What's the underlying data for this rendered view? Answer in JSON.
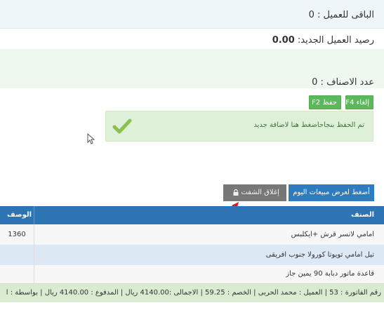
{
  "info": {
    "remaining_label": "الباقى للعميل : 0",
    "new_balance_label": "رصيد العميل الجديد:",
    "new_balance_value": "0.00",
    "items_count_label": "عدد الاصناف :  0"
  },
  "actions": {
    "cancel_label": "إلغاء F4",
    "save_label": "حفظ F2"
  },
  "alert": {
    "message": "تم الحفظ بنجاحاضغط هنا لاضافة جديد"
  },
  "buttons": {
    "today_sales_label": "أضغط لعرض مبيعات اليوم",
    "close_shift_label": "إغلاق الشفت"
  },
  "table": {
    "headers": {
      "item": "الصنف",
      "desc": "الوصف"
    },
    "rows": [
      {
        "name": "امامي لانسر قرش +ايكلبس",
        "desc": "1360"
      },
      {
        "name": "تيل امامي تويوتا كورولا جنوب افريقى",
        "desc": ""
      },
      {
        "name": "قاعدة ماتور دبابة 90 يمين جاز",
        "desc": ""
      }
    ]
  },
  "footer": {
    "text": "رقم الفاتورة : 53 | العميل : محمد الحربى | الخصم : 59.25 | الاجمالى :4140.00 ريال | المدفوع : 4140.00 ريال | بواسطة : ا"
  },
  "colors": {
    "blue": "#2d74b4",
    "green_btn": "#5cb85c",
    "alert_bg": "#dff0d8",
    "gray_btn": "#777777",
    "arrow": "#e01b1b"
  },
  "icons": {
    "check": "check-icon",
    "lock": "lock-icon",
    "cursor": "mouse-cursor-icon",
    "arrow": "red-arrow-icon"
  }
}
